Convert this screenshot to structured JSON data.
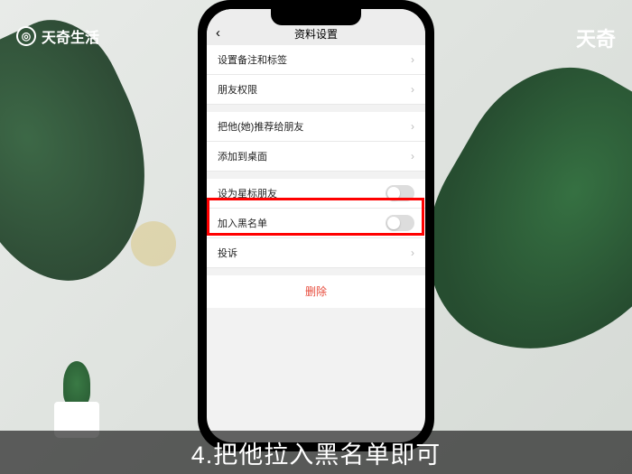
{
  "branding": {
    "left_logo": "天奇生活",
    "right_logo": "天奇"
  },
  "header": {
    "title": "资料设置",
    "back": "‹"
  },
  "rows": {
    "remark": "设置备注和标签",
    "permission": "朋友权限",
    "recommend": "把他(她)推荐给朋友",
    "desktop": "添加到桌面",
    "star": "设为星标朋友",
    "blacklist": "加入黑名单",
    "report": "投诉"
  },
  "actions": {
    "delete": "删除"
  },
  "caption": "4.把他拉入黑名单即可"
}
